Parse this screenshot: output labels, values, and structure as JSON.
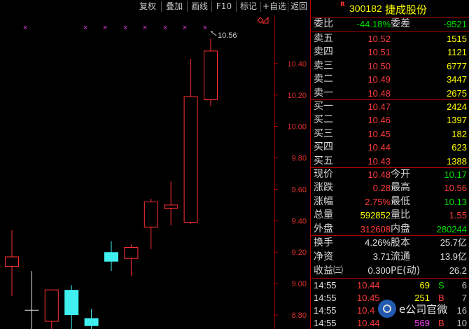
{
  "toolbar": {
    "items": [
      "复权",
      "叠加",
      "画线",
      "F10",
      "标记",
      "+自选",
      "返回"
    ]
  },
  "stock": {
    "flag": "R",
    "code": "300182",
    "name": "捷成股份"
  },
  "commission": {
    "ratio_label": "委比",
    "ratio_value": "-44.18%",
    "diff_label": "委差",
    "diff_value": "-9521"
  },
  "asks": [
    {
      "label": "卖五",
      "price": "10.52",
      "volume": "1515"
    },
    {
      "label": "卖四",
      "price": "10.51",
      "volume": "1121"
    },
    {
      "label": "卖三",
      "price": "10.50",
      "volume": "6777"
    },
    {
      "label": "卖二",
      "price": "10.49",
      "volume": "3447"
    },
    {
      "label": "卖一",
      "price": "10.48",
      "volume": "2675"
    }
  ],
  "bids": [
    {
      "label": "买一",
      "price": "10.47",
      "volume": "2424"
    },
    {
      "label": "买二",
      "price": "10.46",
      "volume": "1397"
    },
    {
      "label": "买三",
      "price": "10.45",
      "volume": "182"
    },
    {
      "label": "买四",
      "price": "10.44",
      "volume": "623"
    },
    {
      "label": "买五",
      "price": "10.43",
      "volume": "1388"
    }
  ],
  "quote": [
    {
      "l1": "现价",
      "v1": "10.48",
      "c1": "red",
      "l2": "今开",
      "v2": "10.17",
      "c2": "green"
    },
    {
      "l1": "涨跌",
      "v1": "0.28",
      "c1": "red",
      "l2": "最高",
      "v2": "10.56",
      "c2": "red"
    },
    {
      "l1": "涨幅",
      "v1": "2.75%",
      "c1": "red",
      "l2": "最低",
      "v2": "10.13",
      "c2": "green"
    },
    {
      "l1": "总量",
      "v1": "592852",
      "c1": "yellow",
      "l2": "量比",
      "v2": "1.55",
      "c2": "red"
    },
    {
      "l1": "外盘",
      "v1": "312608",
      "c1": "red",
      "l2": "内盘",
      "v2": "280244",
      "c2": "green"
    }
  ],
  "fundamentals": [
    {
      "l1": "换手",
      "v1": "4.26%",
      "l2": "股本",
      "v2": "25.7亿"
    },
    {
      "l1": "净资",
      "v1": "3.71",
      "l2": "流通",
      "v2": "13.9亿"
    },
    {
      "l1": "收益㈢",
      "v1": "0.300",
      "l2": "PE(动)",
      "v2": "26.2"
    }
  ],
  "ticks": [
    {
      "time": "14:55",
      "price": "10.44",
      "volume": "69",
      "vol_color": "yellow",
      "dir": "S",
      "dir_color": "green",
      "count": "6"
    },
    {
      "time": "14:55",
      "price": "10.45",
      "volume": "251",
      "vol_color": "yellow",
      "dir": "B",
      "dir_color": "red",
      "count": "7"
    },
    {
      "time": "14:55",
      "price": "10.4",
      "volume": "",
      "vol_color": "yellow",
      "dir": "",
      "dir_color": "red",
      "count": "16"
    },
    {
      "time": "14:55",
      "price": "10.44",
      "volume": "569",
      "vol_color": "magenta",
      "dir": "B",
      "dir_color": "red",
      "count": "10"
    }
  ],
  "watermark": {
    "text": "e公司官微"
  },
  "chart_data": {
    "type": "candlestick",
    "y_ticks": [
      "10.40",
      "10.20",
      "10.00",
      "9.80",
      "9.60",
      "9.40",
      "9.20",
      "9.00",
      "8.80"
    ],
    "ylim": [
      8.72,
      10.68
    ],
    "high_annotation": "10.56",
    "candles": [
      {
        "open": 9.11,
        "close": 9.17,
        "high": 9.34,
        "low": 8.92,
        "dir": "up"
      },
      {
        "open": 8.83,
        "close": 8.83,
        "high": 9.08,
        "low": 8.7,
        "dir": "flat"
      },
      {
        "open": 8.76,
        "close": 8.96,
        "high": 8.96,
        "low": 8.7,
        "dir": "up"
      },
      {
        "open": 8.96,
        "close": 8.8,
        "high": 8.99,
        "low": 8.7,
        "dir": "down"
      },
      {
        "open": 8.78,
        "close": 8.73,
        "high": 8.84,
        "low": 8.7,
        "dir": "down"
      },
      {
        "open": 9.2,
        "close": 9.14,
        "high": 9.27,
        "low": 9.08,
        "dir": "down"
      },
      {
        "open": 9.16,
        "close": 9.23,
        "high": 9.25,
        "low": 9.05,
        "dir": "up"
      },
      {
        "open": 9.36,
        "close": 9.52,
        "high": 9.54,
        "low": 9.22,
        "dir": "up"
      },
      {
        "open": 9.48,
        "close": 9.5,
        "high": 9.65,
        "low": 9.37,
        "dir": "up"
      },
      {
        "open": 9.39,
        "close": 10.19,
        "high": 10.43,
        "low": 9.38,
        "dir": "up"
      },
      {
        "open": 10.17,
        "close": 10.48,
        "high": 10.56,
        "low": 10.13,
        "dir": "up"
      }
    ],
    "top_markers": 9
  }
}
